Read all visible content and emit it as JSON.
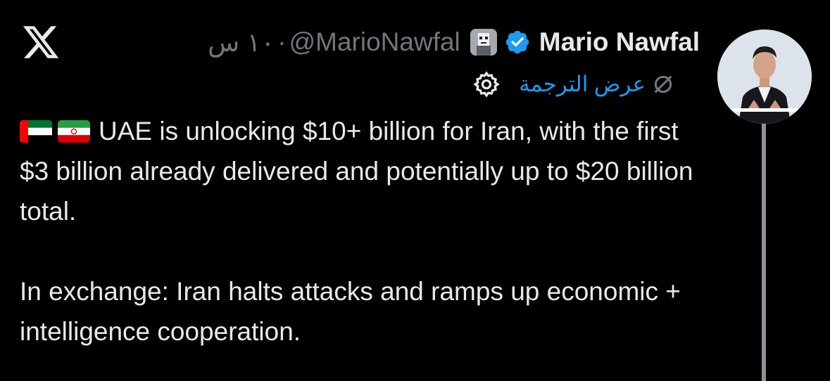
{
  "header": {
    "name": "Mario Nawfal",
    "handle": "@MarioNawfal",
    "time": "١٠ س",
    "time_separator": " · "
  },
  "translation": {
    "label": "عرض الترجمة"
  },
  "post": {
    "flags": [
      "uae-flag",
      "iran-flag"
    ],
    "paragraph1": "UAE is unlocking $10+ billion for Iran, with the first $3 billion already delivered and potentially up to $20 billion total.",
    "paragraph2": "In exchange: Iran halts attacks and ramps up economic + intelligence cooperation."
  },
  "colors": {
    "background": "#000000",
    "text": "#e7e9ea",
    "muted": "#71767b",
    "link": "#1d9bf0",
    "verified": "#1d9bf0"
  }
}
